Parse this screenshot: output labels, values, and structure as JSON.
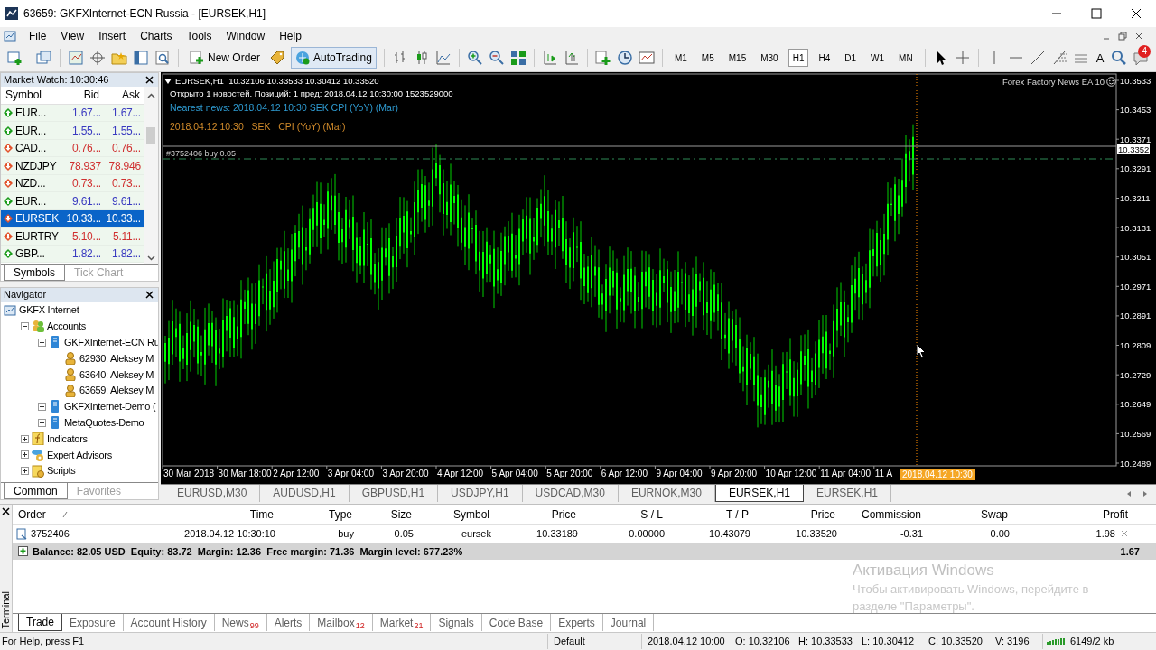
{
  "window": {
    "title": "63659: GKFXInternet-ECN Russia - [EURSEK,H1]"
  },
  "menu": [
    "File",
    "View",
    "Insert",
    "Charts",
    "Tools",
    "Window",
    "Help"
  ],
  "toolbar": {
    "new_order": "New Order",
    "autotrading": "AutoTrading",
    "text_tool": "A",
    "notification_count": "4",
    "timeframes": [
      {
        "label": "M1",
        "selected": false
      },
      {
        "label": "M5",
        "selected": false
      },
      {
        "label": "M15",
        "selected": false
      },
      {
        "label": "M30",
        "selected": false
      },
      {
        "label": "H1",
        "selected": true
      },
      {
        "label": "H4",
        "selected": false
      },
      {
        "label": "D1",
        "selected": false
      },
      {
        "label": "W1",
        "selected": false
      },
      {
        "label": "MN",
        "selected": false
      }
    ]
  },
  "market_watch": {
    "title": "Market Watch: 10:30:46",
    "columns": [
      "Symbol",
      "Bid",
      "Ask"
    ],
    "rows": [
      {
        "symbol": "EUR...",
        "bid": "1.67...",
        "ask": "1.67...",
        "kind": "up",
        "selected": false
      },
      {
        "symbol": "EUR...",
        "bid": "1.55...",
        "ask": "1.55...",
        "kind": "up",
        "selected": false
      },
      {
        "symbol": "CAD...",
        "bid": "0.76...",
        "ask": "0.76...",
        "kind": "down",
        "selected": false
      },
      {
        "symbol": "NZDJPY",
        "bid": "78.937",
        "ask": "78.946",
        "kind": "down",
        "selected": false
      },
      {
        "symbol": "NZD...",
        "bid": "0.73...",
        "ask": "0.73...",
        "kind": "down",
        "selected": false
      },
      {
        "symbol": "EUR...",
        "bid": "9.61...",
        "ask": "9.61...",
        "kind": "up",
        "selected": false
      },
      {
        "symbol": "EURSEK",
        "bid": "10.33...",
        "ask": "10.33...",
        "kind": "down",
        "selected": true
      },
      {
        "symbol": "EURTRY",
        "bid": "5.10...",
        "ask": "5.11...",
        "kind": "down",
        "selected": false
      },
      {
        "symbol": "GBP...",
        "bid": "1.82...",
        "ask": "1.82...",
        "kind": "up",
        "selected": false
      }
    ],
    "tabs": [
      {
        "label": "Symbols",
        "selected": true
      },
      {
        "label": "Tick Chart",
        "selected": false
      }
    ]
  },
  "navigator": {
    "title": "Navigator",
    "tree": [
      {
        "label": "GKFX Internet",
        "kind": "broker",
        "children": [
          {
            "label": "Accounts",
            "kind": "accounts",
            "expanded": true,
            "children": [
              {
                "label": "GKFXInternet-ECN Ru",
                "kind": "server",
                "expanded": true,
                "children": [
                  {
                    "label": "62930: Aleksey M",
                    "kind": "account"
                  },
                  {
                    "label": "63640: Aleksey M",
                    "kind": "account"
                  },
                  {
                    "label": "63659: Aleksey M",
                    "kind": "account"
                  }
                ]
              },
              {
                "label": "GKFXInternet-Demo (",
                "kind": "server",
                "expanded": false
              },
              {
                "label": "MetaQuotes-Demo",
                "kind": "server",
                "expanded": false
              }
            ]
          },
          {
            "label": "Indicators",
            "kind": "indicators",
            "expanded": false
          },
          {
            "label": "Expert Advisors",
            "kind": "experts",
            "expanded": false
          },
          {
            "label": "Scripts",
            "kind": "scripts",
            "expanded": false
          }
        ]
      }
    ],
    "tabs": [
      {
        "label": "Common",
        "selected": true
      },
      {
        "label": "Favorites",
        "selected": false
      }
    ]
  },
  "chart": {
    "header": "EURSEK,H1  10.32106 10.33533 10.30412 10.33520",
    "info": "Открыто 1 новостей. Позиций: 1 пред: 2018.04.12 10:30:00  1523529000",
    "nearest_news": "Nearest news: 2018.04.12 10:30 SEK CPI (YoY) (Mar)",
    "event": "2018.04.12 10:30   SEK   CPI (YoY) (Mar)",
    "order_label": "#3752406 buy 0.05",
    "ea_label": "Forex Factory News EA 10",
    "price_label": "10.3352",
    "time_label": "2018.04.12 10:30",
    "x_axis_labels": [
      "30 Mar 2018",
      "30 Mar 18:00",
      "2 Apr 12:00",
      "3 Apr 04:00",
      "3 Apr 20:00",
      "4 Apr 12:00",
      "5 Apr 04:00",
      "5 Apr 20:00",
      "6 Apr 12:00",
      "9 Apr 04:00",
      "9 Apr 20:00",
      "10 Apr 12:00",
      "11 Apr 04:00",
      "11 A"
    ],
    "y_axis_labels": [
      "10.3533",
      "10.3453",
      "10.3371",
      "10.3291",
      "10.3211",
      "10.3131",
      "10.3051",
      "10.2971",
      "10.2891",
      "10.2809",
      "10.2729",
      "10.2649",
      "10.2569",
      "10.2489"
    ]
  },
  "chart_tabs": [
    {
      "label": "EURUSD,M30",
      "selected": false
    },
    {
      "label": "AUDUSD,H1",
      "selected": false
    },
    {
      "label": "GBPUSD,H1",
      "selected": false
    },
    {
      "label": "USDJPY,H1",
      "selected": false
    },
    {
      "label": "USDCAD,M30",
      "selected": false
    },
    {
      "label": "EURNOK,M30",
      "selected": false
    },
    {
      "label": "EURSEK,H1",
      "selected": true
    },
    {
      "label": "EURSEK,H1",
      "selected": false
    }
  ],
  "terminal": {
    "title": "Terminal",
    "columns": [
      "Order",
      "Time",
      "Type",
      "Size",
      "Symbol",
      "Price",
      "S / L",
      "T / P",
      "Price",
      "Commission",
      "Swap",
      "Profit"
    ],
    "rows": [
      [
        "3752406",
        "2018.04.12 10:30:10",
        "buy",
        "0.05",
        "eursek",
        "10.33189",
        "0.00000",
        "10.43079",
        "10.33520",
        "-0.31",
        "0.00",
        "1.98"
      ]
    ],
    "summary": {
      "text": "Balance: 82.05 USD  Equity: 83.72  Margin: 12.36  Free margin: 71.36  Margin level: 677.23%",
      "profit": "1.67"
    },
    "tabs": [
      {
        "label": "Trade",
        "selected": true
      },
      {
        "label": "Exposure",
        "selected": false
      },
      {
        "label": "Account History",
        "selected": false
      },
      {
        "label": "News",
        "badge": "99",
        "selected": false
      },
      {
        "label": "Alerts",
        "selected": false
      },
      {
        "label": "Mailbox",
        "badge": "12",
        "selected": false
      },
      {
        "label": "Market",
        "badge": "21",
        "selected": false
      },
      {
        "label": "Signals",
        "selected": false
      },
      {
        "label": "Code Base",
        "selected": false
      },
      {
        "label": "Experts",
        "selected": false
      },
      {
        "label": "Journal",
        "selected": false
      }
    ]
  },
  "activation_notice": {
    "title": "Активация Windows",
    "lines": [
      "Чтобы активировать Windows, перейдите в",
      "разделе \"Параметры\"."
    ]
  },
  "status_bar": [
    "For Help, press F1",
    "Default",
    "2018.04.12 10:00",
    "O: 10.32106",
    "H: 10.33533",
    "L: 10.30412",
    "C: 10.33520",
    "V: 3196",
    "6149/2 kb"
  ]
}
